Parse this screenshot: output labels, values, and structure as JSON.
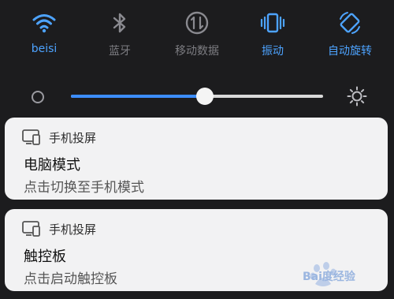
{
  "quick_settings": [
    {
      "label": "beisi",
      "icon": "wifi-icon",
      "state": "on"
    },
    {
      "label": "蓝牙",
      "icon": "bluetooth-icon",
      "state": "off"
    },
    {
      "label": "移动数据",
      "icon": "mobile-data-icon",
      "state": "off"
    },
    {
      "label": "振动",
      "icon": "vibrate-icon",
      "state": "on"
    },
    {
      "label": "自动旋转",
      "icon": "auto-rotate-icon",
      "state": "on"
    }
  ],
  "brightness": {
    "level": 0.53
  },
  "notifications": [
    {
      "app": "手机投屏",
      "title": "电脑模式",
      "subtitle": "点击切换至手机模式"
    },
    {
      "app": "手机投屏",
      "title": "触控板",
      "subtitle": "点击启动触控板"
    }
  ],
  "watermark": {
    "text": "Bai度经验"
  },
  "colors": {
    "accent": "#3c8dff",
    "on_label": "#4da3ff",
    "off_label": "#7d7d82",
    "card_bg": "#f2f2f3",
    "panel_bg": "#1c1c1e"
  }
}
